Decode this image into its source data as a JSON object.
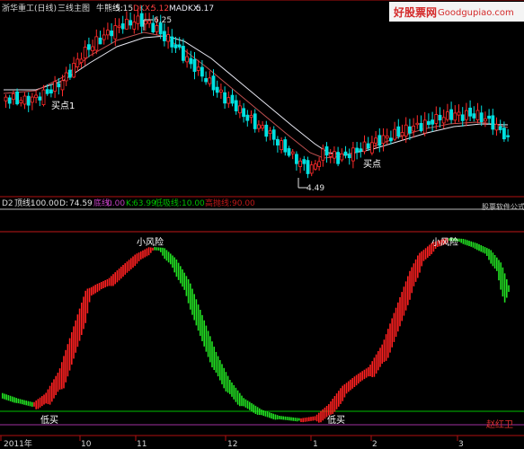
{
  "top_panel": {
    "stock_name": "浙华重工(日线)",
    "indicator_name": "三线主图",
    "niuxiong_label": "牛熊线:",
    "niuxiong_value": "5.15",
    "dkx_label": "DKX:",
    "dkx_value": "5.12",
    "madkx_label": "MADKX:",
    "madkx_value": "5.17",
    "high_marker": "6.25",
    "low_marker": "4.49",
    "buy_label_1": "买点1",
    "buy_label_2": "买点"
  },
  "watermark": {
    "site_cn": "好股票网",
    "site_en": "Goodgupiao.com",
    "corner_text": "股票软件公式"
  },
  "bottom_panel": {
    "index": "D2",
    "top_line_label": "顶线:",
    "top_line_value": "100.00",
    "d_label": "D:",
    "d_value": "74.59",
    "bottom_line_label": "底线:",
    "bottom_line_value": "0.00",
    "k_label": "K:",
    "k_value": "63.99",
    "low_buy_line_label": "低吸线:",
    "low_buy_line_value": "10.00",
    "high_throw_line_label": "高抛线:",
    "high_throw_line_value": "90.00",
    "risk_label_1": "小风险",
    "risk_label_2": "小风险",
    "low_buy_1": "低买",
    "low_buy_2": "低买",
    "author": "赵红卫"
  },
  "time_axis": {
    "labels": [
      "2011年",
      "10",
      "11",
      "12",
      "1",
      "2",
      "3"
    ]
  },
  "colors": {
    "up": "#ff2a2a",
    "down": "#00e0e0",
    "dkx": "#c05050",
    "madkx": "#e6e6f0",
    "kd_rise": "#ff2020",
    "kd_fall": "#22e022",
    "top_line": "#b8b8b8",
    "high_throw": "#c01818",
    "low_buy": "#00c000",
    "frame": "#b01010"
  },
  "chart_data": [
    {
      "type": "candlestick",
      "title": "",
      "categories": [
        "2011年",
        "10",
        "11",
        "12",
        "1",
        "2",
        "3"
      ],
      "series": [
        {
          "name": "DKX",
          "values": [
            5.12
          ]
        },
        {
          "name": "MADKX",
          "values": [
            5.17
          ]
        },
        {
          "name": "牛熊线",
          "values": [
            5.15
          ]
        }
      ],
      "price_high": 6.25,
      "price_low": 4.49,
      "ylim": [
        4.4,
        6.35
      ],
      "grid": false
    },
    {
      "type": "area",
      "title": "",
      "categories": [
        "2011年",
        "10",
        "11",
        "12",
        "1",
        "2",
        "3"
      ],
      "series": [
        {
          "name": "顶线",
          "values": [
            100.0
          ]
        },
        {
          "name": "底线",
          "values": [
            0.0
          ]
        },
        {
          "name": "低吸线",
          "values": [
            10.0
          ]
        },
        {
          "name": "高抛线",
          "values": [
            90.0
          ]
        },
        {
          "name": "D",
          "values": [
            74.59
          ]
        },
        {
          "name": "K",
          "values": [
            63.99
          ]
        }
      ],
      "ylim": [
        0,
        100
      ],
      "grid": false
    }
  ]
}
